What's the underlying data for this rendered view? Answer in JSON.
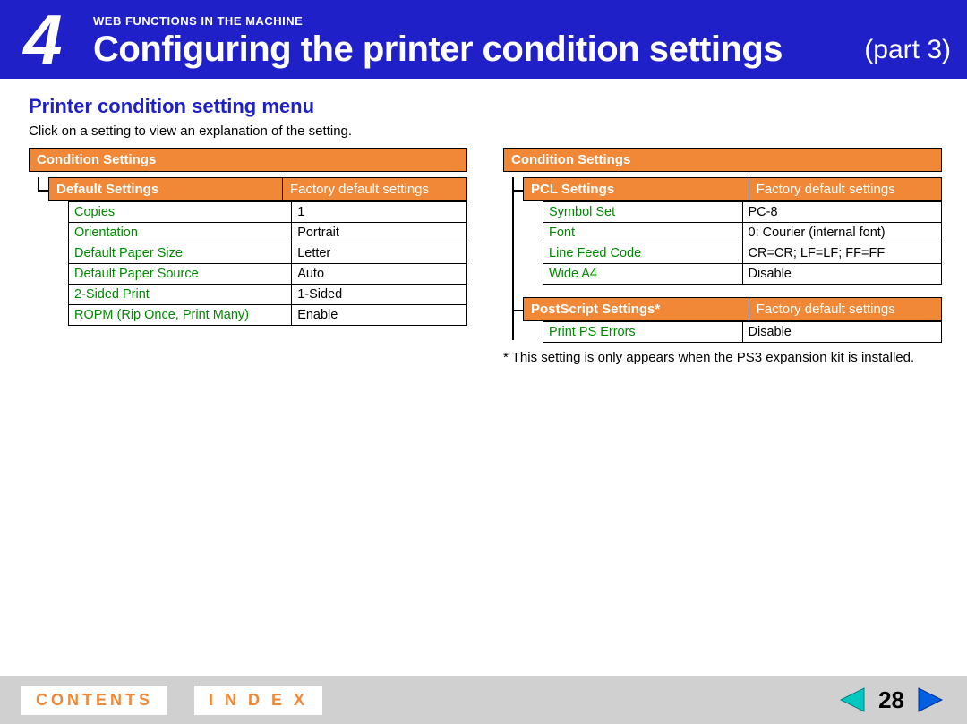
{
  "header": {
    "chapter_number": "4",
    "breadcrumb": "WEB FUNCTIONS IN THE MACHINE",
    "title": "Configuring the printer condition settings",
    "part": "(part 3)"
  },
  "section": {
    "title": "Printer condition setting menu",
    "intro": "Click on a setting to view an explanation of the setting."
  },
  "left": {
    "panel_title": "Condition Settings",
    "group_title": "Default Settings",
    "factory_label": "Factory default settings",
    "rows": [
      {
        "key": "Copies",
        "value": "1"
      },
      {
        "key": "Orientation",
        "value": "Portrait"
      },
      {
        "key": "Default Paper Size",
        "value": "Letter"
      },
      {
        "key": "Default Paper Source",
        "value": "Auto"
      },
      {
        "key": "2-Sided Print",
        "value": "1-Sided"
      },
      {
        "key": "ROPM (Rip Once, Print Many)",
        "value": "Enable"
      }
    ]
  },
  "right": {
    "panel_title": "Condition Settings",
    "group1_title": "PCL Settings",
    "factory_label": "Factory default settings",
    "group1_rows": [
      {
        "key": "Symbol Set",
        "value": "PC-8"
      },
      {
        "key": "Font",
        "value": "0: Courier (internal font)"
      },
      {
        "key": "Line Feed Code",
        "value": "CR=CR; LF=LF; FF=FF"
      },
      {
        "key": "Wide A4",
        "value": "Disable"
      }
    ],
    "group2_title": "PostScript Settings*",
    "group2_rows": [
      {
        "key": "Print PS Errors",
        "value": "Disable"
      }
    ],
    "note": "*  This setting is only appears when the PS3 expansion kit is installed."
  },
  "footer": {
    "contents": "CONTENTS",
    "index": "I N D E X",
    "page": "28"
  }
}
